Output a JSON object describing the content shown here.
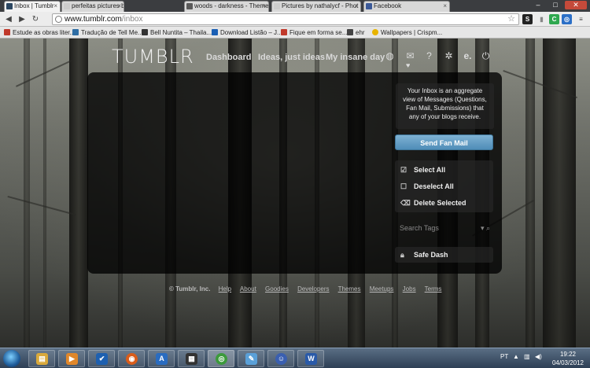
{
  "browser": {
    "tabs": [
      {
        "label": "Inbox | Tumblr",
        "active": true,
        "favicon_color": "#2c4762"
      },
      {
        "label": "perfeitas pictures by nathaly",
        "active": false,
        "favicon_color": "#cccccc"
      },
      {
        "label": "woods - darkness - Themes",
        "active": false,
        "favicon_color": "#5a5a5a"
      },
      {
        "label": "Pictures by nathalycf - Phot",
        "active": false,
        "favicon_color": "#cccccc"
      },
      {
        "label": "Facebook",
        "active": false,
        "favicon_color": "#3b5998"
      }
    ],
    "address": {
      "host": "www.tumblr.com",
      "path": "/inbox"
    },
    "bookmarks": [
      {
        "label": "Estude as obras liter...",
        "icon_color": "#c0392b"
      },
      {
        "label": "Tradução de Tell Me...",
        "icon_color": "#2e6da4"
      },
      {
        "label": "Bell Nuntita – Thaila...",
        "icon_color": "#333333"
      },
      {
        "label": "Download Listão – J...",
        "icon_color": "#1a5fb4"
      },
      {
        "label": "Fique em forma se...",
        "icon_color": "#c0392b"
      },
      {
        "label": "ehr",
        "icon_color": "#444444"
      },
      {
        "label": "Wallpapers | Crispm...",
        "icon_color": "#e8b400"
      }
    ]
  },
  "tumblr": {
    "logo": "TUMBLR",
    "nav": [
      "Dashboard",
      "Ideas, just ideas",
      "My insane day"
    ],
    "icons": [
      "globe-icon",
      "mail-heart-icon",
      "help-icon",
      "gear-icon",
      "e-icon",
      "power-icon"
    ],
    "info_text": "Your Inbox is an aggregate view of Messages (Questions, Fan Mail, Submissions) that any of your blogs receive.",
    "fan_mail_button": "Send Fan Mail",
    "actions": [
      {
        "label": "Select All",
        "icon": "select-all-icon"
      },
      {
        "label": "Deselect All",
        "icon": "deselect-all-icon"
      },
      {
        "label": "Delete Selected",
        "icon": "delete-selected-icon"
      }
    ],
    "search_tags_placeholder": "Search Tags",
    "safe_dash": "Safe Dash",
    "footer": {
      "copyright": "© Tumblr, Inc.",
      "links": [
        "Help",
        "About",
        "Goodies",
        "Developers",
        "Themes",
        "Meetups",
        "Jobs",
        "Terms"
      ]
    }
  },
  "taskbar": {
    "language": "PT",
    "time": "19:22",
    "date": "04/03/2012",
    "apps": [
      {
        "name": "explorer-taskbar-icon",
        "color": "#d9a93b"
      },
      {
        "name": "media-player-taskbar-icon",
        "color": "#e0872a"
      },
      {
        "name": "checkmark-app-taskbar-icon",
        "color": "#1e60b0"
      },
      {
        "name": "firefox-taskbar-icon",
        "color": "#d95c1a"
      },
      {
        "name": "app-a-taskbar-icon",
        "color": "#2a6cc0"
      },
      {
        "name": "film-app-taskbar-icon",
        "color": "#333333"
      },
      {
        "name": "chrome-taskbar-icon",
        "color": "#3c9a3c"
      },
      {
        "name": "paint-taskbar-icon",
        "color": "#5aa0d8"
      },
      {
        "name": "messenger-taskbar-icon",
        "color": "#3a5fb0"
      },
      {
        "name": "word-taskbar-icon",
        "color": "#2a5aa8"
      }
    ]
  }
}
